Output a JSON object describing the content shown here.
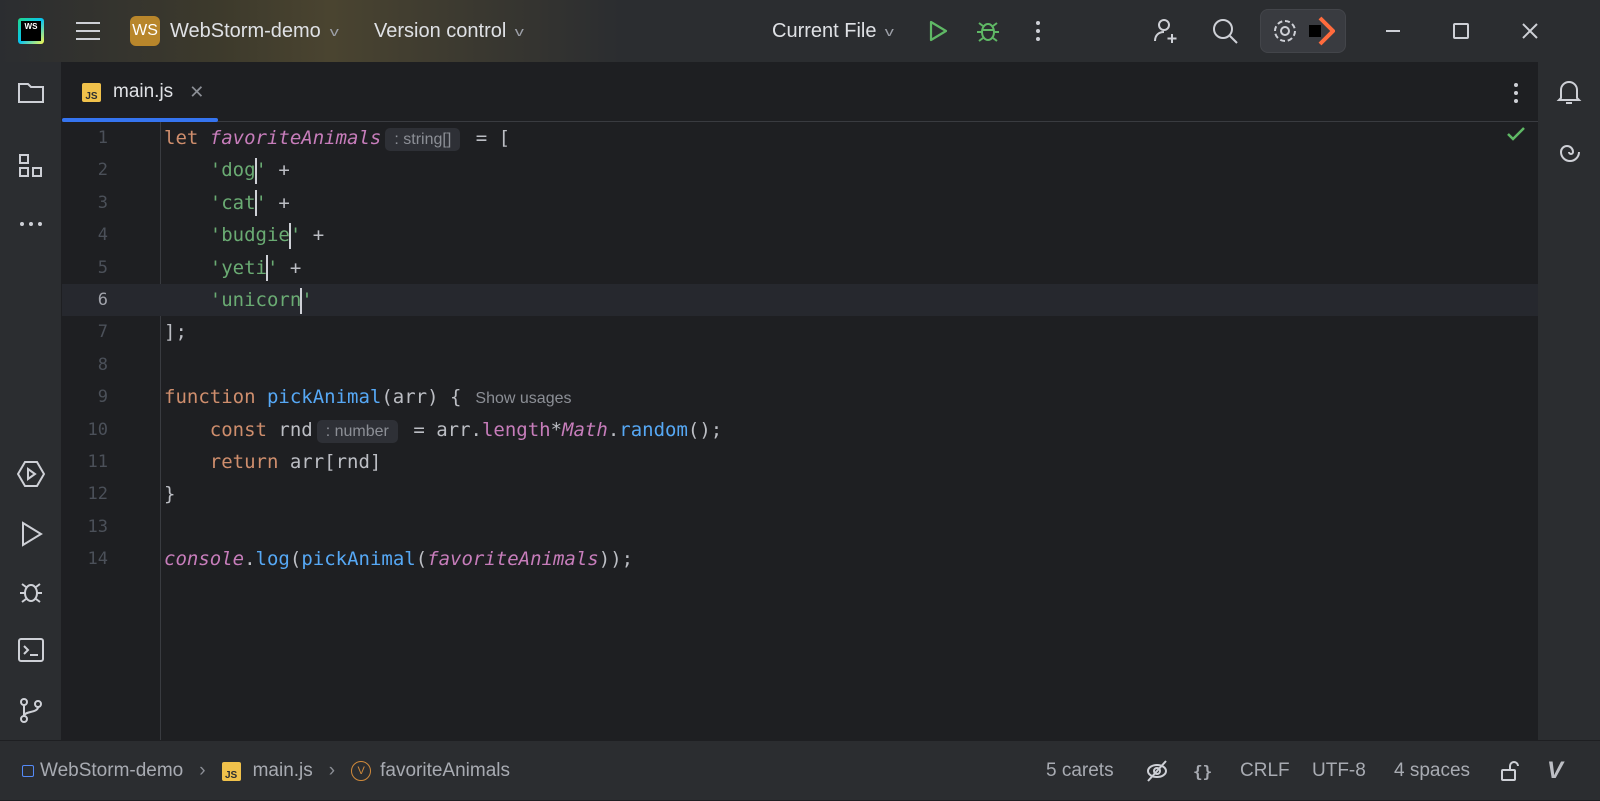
{
  "titlebar": {
    "project_badge": "WS",
    "project": "WebStorm-demo",
    "vcs": "Version control",
    "run_config": "Current File",
    "logo_text": "WS"
  },
  "tab": {
    "label": "main.js",
    "icon": "JS"
  },
  "editor": {
    "current_line": 6,
    "lines": [
      [
        {
          "t": "kw",
          "v": "let "
        },
        {
          "t": "gv",
          "v": "favoriteAnimals"
        },
        {
          "t": "hint",
          "v": ": string[]"
        },
        {
          "t": "pl",
          "v": " = ["
        }
      ],
      [
        {
          "t": "pl",
          "v": "    "
        },
        {
          "t": "str",
          "v": "'dog"
        },
        {
          "t": "caret"
        },
        {
          "t": "str",
          "v": "'"
        },
        {
          "t": "pl",
          "v": " +"
        }
      ],
      [
        {
          "t": "pl",
          "v": "    "
        },
        {
          "t": "str",
          "v": "'cat"
        },
        {
          "t": "caret"
        },
        {
          "t": "str",
          "v": "'"
        },
        {
          "t": "pl",
          "v": " +"
        }
      ],
      [
        {
          "t": "pl",
          "v": "    "
        },
        {
          "t": "str",
          "v": "'budgie"
        },
        {
          "t": "caret"
        },
        {
          "t": "str",
          "v": "'"
        },
        {
          "t": "pl",
          "v": " +"
        }
      ],
      [
        {
          "t": "pl",
          "v": "    "
        },
        {
          "t": "str",
          "v": "'yeti"
        },
        {
          "t": "caret"
        },
        {
          "t": "str",
          "v": "'"
        },
        {
          "t": "pl",
          "v": " +"
        }
      ],
      [
        {
          "t": "pl",
          "v": "    "
        },
        {
          "t": "str",
          "v": "'unicorn"
        },
        {
          "t": "caret"
        },
        {
          "t": "str",
          "v": "'"
        }
      ],
      [
        {
          "t": "pl",
          "v": "];"
        }
      ],
      [],
      [
        {
          "t": "kw",
          "v": "function "
        },
        {
          "t": "fn",
          "v": "pickAnimal"
        },
        {
          "t": "pl",
          "v": "(arr) {"
        },
        {
          "t": "usage",
          "v": "Show usages"
        }
      ],
      [
        {
          "t": "pl",
          "v": "    "
        },
        {
          "t": "kw",
          "v": "const "
        },
        {
          "t": "pl",
          "v": "rnd"
        },
        {
          "t": "hint",
          "v": ": number"
        },
        {
          "t": "pl",
          "v": " = arr."
        },
        {
          "t": "prop",
          "v": "length"
        },
        {
          "t": "pl",
          "v": "*"
        },
        {
          "t": "gv",
          "v": "Math"
        },
        {
          "t": "pl",
          "v": "."
        },
        {
          "t": "fn",
          "v": "random"
        },
        {
          "t": "pl",
          "v": "();"
        }
      ],
      [
        {
          "t": "pl",
          "v": "    "
        },
        {
          "t": "kw",
          "v": "return "
        },
        {
          "t": "pl",
          "v": "arr[rnd]"
        }
      ],
      [
        {
          "t": "pl",
          "v": "}"
        }
      ],
      [],
      [
        {
          "t": "gv",
          "v": "console"
        },
        {
          "t": "pl",
          "v": "."
        },
        {
          "t": "fn",
          "v": "log"
        },
        {
          "t": "pl",
          "v": "("
        },
        {
          "t": "fn",
          "v": "pickAnimal"
        },
        {
          "t": "pl",
          "v": "("
        },
        {
          "t": "gv",
          "v": "favoriteAnimals"
        },
        {
          "t": "pl",
          "v": "));"
        }
      ]
    ]
  },
  "statusbar": {
    "breadcrumbs": [
      "WebStorm-demo",
      "main.js",
      "favoriteAnimals"
    ],
    "js_icon": "JS",
    "var_icon": "V",
    "carets": "5 carets",
    "braces": "{}",
    "line_sep": "CRLF",
    "encoding": "UTF-8",
    "indent": "4 spaces"
  },
  "colors": {
    "accent": "#3574f0",
    "run": "#5fb865",
    "inspection_ok": "#5fb865"
  }
}
